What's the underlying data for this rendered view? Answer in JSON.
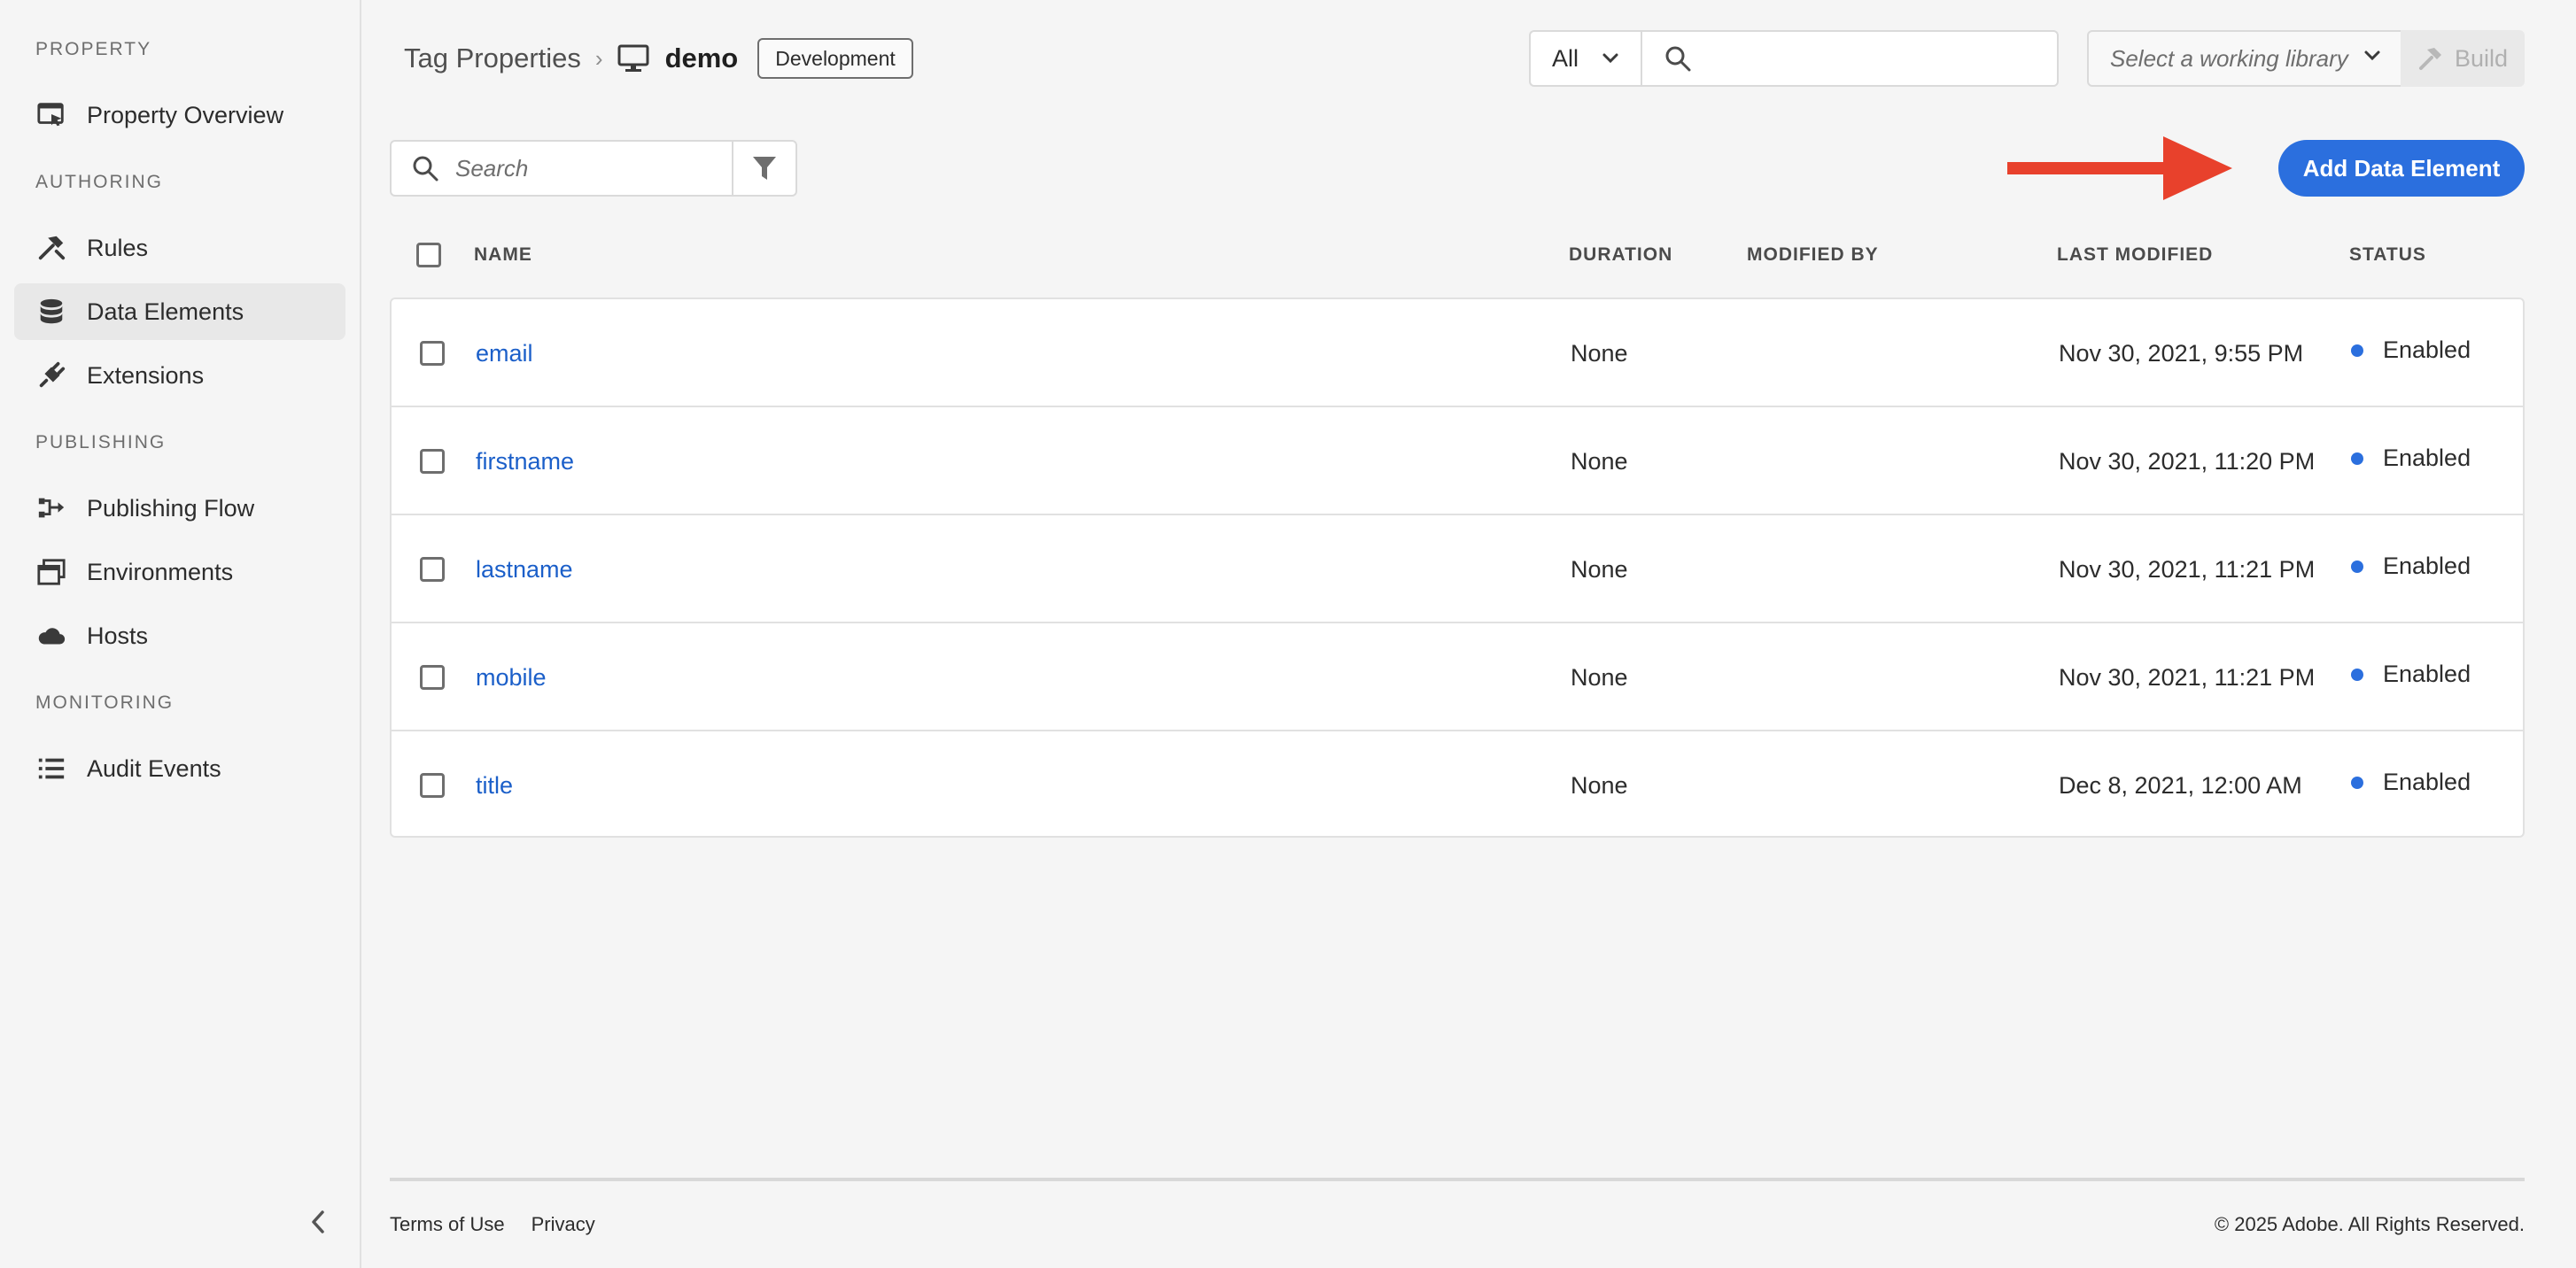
{
  "sidebar": {
    "sections": [
      "PROPERTY",
      "AUTHORING",
      "PUBLISHING",
      "MONITORING"
    ],
    "items": [
      {
        "label": "Property Overview",
        "icon": "property-overview-icon"
      },
      {
        "label": "Rules",
        "icon": "rules-icon"
      },
      {
        "label": "Data Elements",
        "icon": "data-elements-icon",
        "active": true
      },
      {
        "label": "Extensions",
        "icon": "extensions-icon"
      },
      {
        "label": "Publishing Flow",
        "icon": "publishing-flow-icon"
      },
      {
        "label": "Environments",
        "icon": "environments-icon"
      },
      {
        "label": "Hosts",
        "icon": "cloud-icon"
      },
      {
        "label": "Audit Events",
        "icon": "list-icon"
      }
    ]
  },
  "header": {
    "breadcrumb_root": "Tag Properties",
    "property_name": "demo",
    "environment_badge": "Development",
    "scope_value": "All",
    "search_placeholder": "",
    "library_placeholder": "Select a working library",
    "build_label": "Build"
  },
  "toolbar": {
    "search_placeholder": "Search",
    "add_button_label": "Add Data Element"
  },
  "table": {
    "columns": {
      "name": "NAME",
      "duration": "DURATION",
      "modified_by": "MODIFIED BY",
      "last_modified": "LAST MODIFIED",
      "status": "STATUS"
    },
    "rows": [
      {
        "name": "email",
        "duration": "None",
        "modified_by": "",
        "last_modified": "Nov 30, 2021, 9:55 PM",
        "status": "Enabled"
      },
      {
        "name": "firstname",
        "duration": "None",
        "modified_by": "",
        "last_modified": "Nov 30, 2021, 11:20 PM",
        "status": "Enabled"
      },
      {
        "name": "lastname",
        "duration": "None",
        "modified_by": "",
        "last_modified": "Nov 30, 2021, 11:21 PM",
        "status": "Enabled"
      },
      {
        "name": "mobile",
        "duration": "None",
        "modified_by": "",
        "last_modified": "Nov 30, 2021, 11:21 PM",
        "status": "Enabled"
      },
      {
        "name": "title",
        "duration": "None",
        "modified_by": "",
        "last_modified": "Dec 8, 2021, 12:00 AM",
        "status": "Enabled"
      }
    ]
  },
  "footer": {
    "terms": "Terms of Use",
    "privacy": "Privacy",
    "copyright": "© 2025 Adobe. All Rights Reserved."
  },
  "colors": {
    "accent": "#2b6fde",
    "link": "#1b5fc9",
    "annotation_arrow": "#e8412c"
  }
}
